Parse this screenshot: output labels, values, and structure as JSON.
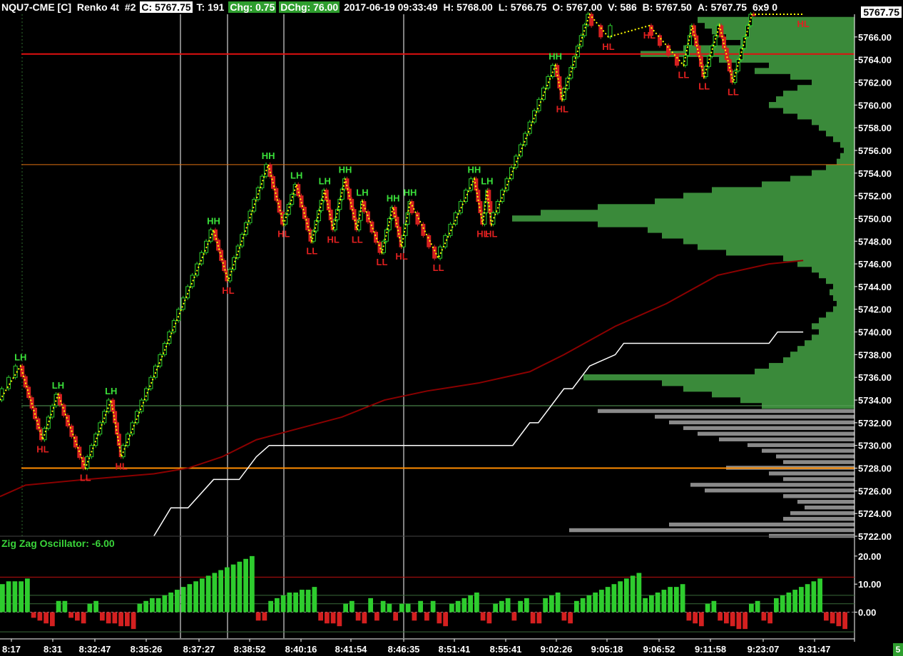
{
  "header": {
    "symbol": "NQU7-CME [C]",
    "chart_type": "Renko 4t",
    "chart_num": "#2",
    "close": "C: 5767.75",
    "ticks": "T: 191",
    "change": "Chg: 0.75",
    "dchange": "DChg: 76.00",
    "datetime": "2017-06-19 09:33:49",
    "high": "H: 5768.00",
    "low": "L: 5766.75",
    "open": "O: 5767.00",
    "volume": "V: 586",
    "bid": "B: 5767.50",
    "ask": "A: 5767.75",
    "extra": "6x9 0"
  },
  "current_price": "5767.75",
  "oscillator_label": "Zig Zag Oscillator: -6.00",
  "corner_badge": "5",
  "colors": {
    "up_bar": "#2ecc2e",
    "down_bar": "#d42020",
    "zigzag": "#ffff00",
    "ma_line": "#8b0000",
    "white_line": "#ffffff",
    "profile_green": "#3a8a3a",
    "profile_gray": "#8a8a8a",
    "hh_label": "#3ae03a",
    "ll_label": "#e02020"
  },
  "chart_data": {
    "type": "line",
    "price_axis": {
      "ticks": [
        "5766.00",
        "5764.00",
        "5762.00",
        "5760.00",
        "5758.00",
        "5756.00",
        "5754.00",
        "5752.00",
        "5750.00",
        "5748.00",
        "5746.00",
        "5744.00",
        "5742.00",
        "5740.00",
        "5738.00",
        "5736.00",
        "5734.00",
        "5732.00",
        "5730.00",
        "5728.00",
        "5726.00",
        "5724.00",
        "5722.00"
      ],
      "range": [
        5722,
        5768
      ]
    },
    "time_axis": [
      "8:17",
      "8:31",
      "8:32:47",
      "8:35:26",
      "8:37:27",
      "8:38:52",
      "8:40:16",
      "8:41:54",
      "8:46:35",
      "8:51:41",
      "8:55:41",
      "9:02:26",
      "9:05:18",
      "9:06:52",
      "9:11:58",
      "9:23:07",
      "9:31:47"
    ],
    "oscillator_axis": {
      "ticks": [
        "20.00",
        "10.00",
        "0.00"
      ],
      "range": [
        -8,
        22
      ]
    },
    "horizontal_lines": [
      {
        "price": 5764.5,
        "color": "#e01010",
        "width": 2
      },
      {
        "price": 5754.75,
        "color": "#e07010",
        "width": 1
      },
      {
        "price": 5733.5,
        "color": "#5aa05a",
        "width": 1
      },
      {
        "price": 5728.0,
        "color": "#ff8c00",
        "width": 2
      }
    ],
    "zigzag_points": [
      {
        "x": 0,
        "y": 5734.0
      },
      {
        "x": 0.024,
        "y": 5737.0,
        "label": "LH"
      },
      {
        "x": 0.05,
        "y": 5730.5,
        "label": "HL"
      },
      {
        "x": 0.068,
        "y": 5734.5,
        "label": "LH"
      },
      {
        "x": 0.1,
        "y": 5728.0,
        "label": "LL"
      },
      {
        "x": 0.13,
        "y": 5734.0,
        "label": "LH"
      },
      {
        "x": 0.142,
        "y": 5729.0,
        "label": "HL"
      },
      {
        "x": 0.25,
        "y": 5749.0,
        "label": "HH"
      },
      {
        "x": 0.267,
        "y": 5744.5,
        "label": "HL"
      },
      {
        "x": 0.314,
        "y": 5754.75,
        "label": "HH"
      },
      {
        "x": 0.332,
        "y": 5749.5,
        "label": "HL"
      },
      {
        "x": 0.347,
        "y": 5753.0,
        "label": "LH"
      },
      {
        "x": 0.365,
        "y": 5748.0,
        "label": "LL"
      },
      {
        "x": 0.38,
        "y": 5752.5,
        "label": "LH"
      },
      {
        "x": 0.39,
        "y": 5749.0,
        "label": "HL"
      },
      {
        "x": 0.404,
        "y": 5753.5,
        "label": "HH"
      },
      {
        "x": 0.418,
        "y": 5749.0,
        "label": "LL"
      },
      {
        "x": 0.424,
        "y": 5751.5,
        "label": "LH"
      },
      {
        "x": 0.447,
        "y": 5747.0,
        "label": "LL"
      },
      {
        "x": 0.46,
        "y": 5751.0,
        "label": "HH"
      },
      {
        "x": 0.47,
        "y": 5747.5,
        "label": "HL"
      },
      {
        "x": 0.48,
        "y": 5751.5,
        "label": "HH"
      },
      {
        "x": 0.513,
        "y": 5746.5,
        "label": "LL"
      },
      {
        "x": 0.555,
        "y": 5753.5,
        "label": "HH"
      },
      {
        "x": 0.565,
        "y": 5749.5,
        "label": "HL"
      },
      {
        "x": 0.57,
        "y": 5752.5,
        "label": "LH"
      },
      {
        "x": 0.575,
        "y": 5749.5,
        "label": "HL"
      },
      {
        "x": 0.65,
        "y": 5763.5,
        "label": "HH"
      },
      {
        "x": 0.658,
        "y": 5760.5,
        "label": "HL"
      },
      {
        "x": 0.69,
        "y": 5768.0
      },
      {
        "x": 0.712,
        "y": 5766.0,
        "label": "HL"
      },
      {
        "x": 0.76,
        "y": 5767.0,
        "label": "HL"
      },
      {
        "x": 0.8,
        "y": 5763.5,
        "label": "LL"
      },
      {
        "x": 0.81,
        "y": 5767.0
      },
      {
        "x": 0.824,
        "y": 5762.5,
        "label": "LL"
      },
      {
        "x": 0.842,
        "y": 5767.0
      },
      {
        "x": 0.858,
        "y": 5762.0,
        "label": "LL"
      },
      {
        "x": 0.88,
        "y": 5768.0
      },
      {
        "x": 0.94,
        "y": 5768.0,
        "label": "HL"
      }
    ],
    "ma_line": [
      [
        0,
        5725.5
      ],
      [
        0.03,
        5726.5
      ],
      [
        0.1,
        5727.0
      ],
      [
        0.18,
        5727.5
      ],
      [
        0.22,
        5728.0
      ],
      [
        0.26,
        5729.0
      ],
      [
        0.3,
        5730.5
      ],
      [
        0.35,
        5731.5
      ],
      [
        0.4,
        5732.5
      ],
      [
        0.45,
        5734.0
      ],
      [
        0.5,
        5734.8
      ],
      [
        0.56,
        5735.5
      ],
      [
        0.62,
        5736.5
      ],
      [
        0.66,
        5738.0
      ],
      [
        0.72,
        5740.5
      ],
      [
        0.78,
        5742.5
      ],
      [
        0.84,
        5745.0
      ],
      [
        0.9,
        5746.0
      ],
      [
        0.94,
        5746.3
      ]
    ],
    "white_line": [
      [
        0.18,
        5722
      ],
      [
        0.2,
        5724.5
      ],
      [
        0.22,
        5724.5
      ],
      [
        0.25,
        5727.0
      ],
      [
        0.28,
        5727.0
      ],
      [
        0.3,
        5729.0
      ],
      [
        0.315,
        5730.0
      ],
      [
        0.6,
        5730.0
      ],
      [
        0.62,
        5732.0
      ],
      [
        0.63,
        5732.0
      ],
      [
        0.66,
        5735.0
      ],
      [
        0.67,
        5735.0
      ],
      [
        0.69,
        5737.0
      ],
      [
        0.72,
        5738.0
      ],
      [
        0.73,
        5739.0
      ],
      [
        0.9,
        5739.0
      ],
      [
        0.91,
        5740.0
      ],
      [
        0.94,
        5740.0
      ]
    ],
    "oscillator_values": [
      10,
      11,
      11,
      11,
      12,
      -2,
      -3,
      -4,
      -5,
      4,
      4,
      -2,
      -3,
      -4,
      3,
      4,
      -3,
      -4,
      -4,
      -5,
      -5,
      -6,
      3,
      4,
      5,
      5,
      6,
      7,
      8,
      9,
      10,
      11,
      12,
      13,
      14,
      15,
      16,
      17,
      18,
      19,
      20,
      -3,
      -3,
      4,
      5,
      6,
      7,
      7,
      8,
      8,
      9,
      -3,
      -4,
      -4,
      -5,
      3,
      4,
      -3,
      -4,
      5,
      -3,
      4,
      3,
      -3,
      3,
      3,
      -3,
      4,
      -3,
      4,
      -4,
      -5,
      3,
      4,
      5,
      6,
      7,
      -3,
      -4,
      3,
      4,
      5,
      -3,
      4,
      5,
      -4,
      -4,
      5,
      6,
      7,
      -3,
      -4,
      4,
      5,
      6,
      7,
      8,
      9,
      10,
      11,
      12,
      13,
      14,
      5,
      6,
      7,
      8,
      9,
      9,
      10,
      -3,
      -4,
      -5,
      3,
      4,
      -3,
      -4,
      -5,
      -6,
      -6,
      3,
      4,
      -3,
      -4,
      5,
      6,
      7,
      8,
      9,
      10,
      11,
      12,
      -3,
      -4,
      -5,
      -6
    ],
    "volume_profile_green": [
      [
        5767.5,
        220
      ],
      [
        5767.0,
        210
      ],
      [
        5766.5,
        200
      ],
      [
        5766.0,
        180
      ],
      [
        5765.5,
        160
      ],
      [
        5765.0,
        240
      ],
      [
        5764.5,
        300
      ],
      [
        5764.0,
        190
      ],
      [
        5763.5,
        120
      ],
      [
        5763.0,
        140
      ],
      [
        5762.5,
        90
      ],
      [
        5762.0,
        60
      ],
      [
        5761.5,
        80
      ],
      [
        5761.0,
        100
      ],
      [
        5760.5,
        110
      ],
      [
        5760.0,
        120
      ],
      [
        5759.5,
        100
      ],
      [
        5759.0,
        80
      ],
      [
        5758.5,
        60
      ],
      [
        5758.0,
        50
      ],
      [
        5757.5,
        40
      ],
      [
        5757.0,
        30
      ],
      [
        5756.5,
        20
      ],
      [
        5756.0,
        15
      ],
      [
        5755.5,
        20
      ],
      [
        5755.0,
        25
      ],
      [
        5754.5,
        40
      ],
      [
        5754.0,
        60
      ],
      [
        5753.5,
        90
      ],
      [
        5753.0,
        130
      ],
      [
        5752.5,
        200
      ],
      [
        5752.0,
        240
      ],
      [
        5751.5,
        280
      ],
      [
        5751.0,
        360
      ],
      [
        5750.5,
        440
      ],
      [
        5750.0,
        480
      ],
      [
        5749.5,
        360
      ],
      [
        5749.0,
        290
      ],
      [
        5748.5,
        270
      ],
      [
        5748.0,
        240
      ],
      [
        5747.5,
        220
      ],
      [
        5747.0,
        180
      ],
      [
        5746.5,
        100
      ],
      [
        5746.0,
        80
      ],
      [
        5745.5,
        60
      ],
      [
        5745.0,
        50
      ],
      [
        5744.5,
        40
      ],
      [
        5744.0,
        30
      ],
      [
        5743.5,
        35
      ],
      [
        5743.0,
        30
      ],
      [
        5742.5,
        25
      ],
      [
        5742.0,
        30
      ],
      [
        5741.5,
        40
      ],
      [
        5741.0,
        50
      ],
      [
        5740.5,
        60
      ],
      [
        5740.0,
        50
      ],
      [
        5739.5,
        60
      ],
      [
        5739.0,
        70
      ],
      [
        5738.5,
        80
      ],
      [
        5738.0,
        90
      ],
      [
        5737.5,
        100
      ],
      [
        5737.0,
        120
      ],
      [
        5736.5,
        140
      ],
      [
        5736.0,
        380
      ],
      [
        5735.5,
        270
      ],
      [
        5735.0,
        240
      ],
      [
        5734.5,
        200
      ],
      [
        5734.0,
        160
      ],
      [
        5733.5,
        130
      ]
    ],
    "volume_profile_gray": [
      [
        5733.0,
        360
      ],
      [
        5732.5,
        280
      ],
      [
        5732.0,
        260
      ],
      [
        5731.5,
        240
      ],
      [
        5731.0,
        220
      ],
      [
        5730.5,
        190
      ],
      [
        5730.0,
        150
      ],
      [
        5729.5,
        130
      ],
      [
        5729.0,
        110
      ],
      [
        5728.5,
        100
      ],
      [
        5728.0,
        180
      ],
      [
        5727.5,
        120
      ],
      [
        5727.0,
        100
      ],
      [
        5726.5,
        230
      ],
      [
        5726.0,
        210
      ],
      [
        5725.5,
        100
      ],
      [
        5725.0,
        80
      ],
      [
        5724.5,
        70
      ],
      [
        5724.0,
        90
      ],
      [
        5723.5,
        100
      ],
      [
        5723.0,
        260
      ],
      [
        5722.5,
        400
      ],
      [
        5722.0,
        120
      ]
    ]
  }
}
